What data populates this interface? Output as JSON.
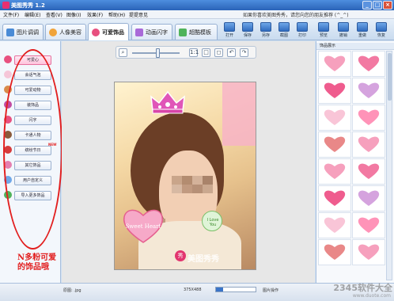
{
  "window": {
    "title": "美图秀秀 1.2",
    "controls": [
      "_",
      "□",
      "×"
    ]
  },
  "menu": {
    "items": [
      "文件(F)",
      "编辑(E)",
      "查看(V)",
      "图像(I)",
      "效果(F)",
      "帮助(H)",
      "提提意见"
    ],
    "promo": "如果你喜欢美图秀秀，请您向您的朋友推荐 (^_^)"
  },
  "tabs": [
    {
      "label": "图片调调",
      "icon": "image-adjust-icon",
      "active": false
    },
    {
      "label": "人像美容",
      "icon": "portrait-icon",
      "active": false
    },
    {
      "label": "可爱饰品",
      "icon": "decoration-icon",
      "active": true
    },
    {
      "label": "动画闪字",
      "icon": "animation-icon",
      "active": false
    },
    {
      "label": "超酷模板",
      "icon": "template-icon",
      "active": false
    }
  ],
  "toolbar": {
    "buttons": [
      "打开",
      "保存",
      "另存",
      "截图",
      "打印",
      "预览",
      "撤销",
      "重做",
      "恢复"
    ]
  },
  "sidebar": {
    "items": [
      {
        "label": "可爱心",
        "active": true
      },
      {
        "label": "会话气泡",
        "active": false
      },
      {
        "label": "可爱动物",
        "active": false
      },
      {
        "label": "装饰品",
        "active": false
      },
      {
        "label": "闪字",
        "active": false
      },
      {
        "label": "卡通人物",
        "active": false
      },
      {
        "label": "缤纷节日",
        "active": false
      },
      {
        "label": "其它饰品",
        "active": false
      },
      {
        "label": "用户自定义",
        "active": false
      },
      {
        "label": "导入更多饰品",
        "active": false
      }
    ],
    "new_badge": "NEW"
  },
  "annotation": {
    "text": "N多粉可爱的饰品哦",
    "color": "#e21f1f"
  },
  "canvas": {
    "zoom_buttons": [
      "1:1",
      "□",
      "◻",
      "↶",
      "↷"
    ],
    "zoom_level": 0.55,
    "watermark_text": "美图秀秀",
    "sticker_text": "Sweet Heart",
    "round_sticker_text": "I Love You"
  },
  "right_panel": {
    "title": "饰品展示",
    "thumb_count": 16
  },
  "status": {
    "filename": "原图: .jpg",
    "size": "375X488",
    "mode": "图片操作",
    "progress": 0.18
  },
  "site_watermark": {
    "text": "2345软件大全",
    "url": "www.duote.com"
  },
  "colors": {
    "accent": "#2a63b8",
    "pink": "#e8507f",
    "annotation": "#e21f1f"
  }
}
